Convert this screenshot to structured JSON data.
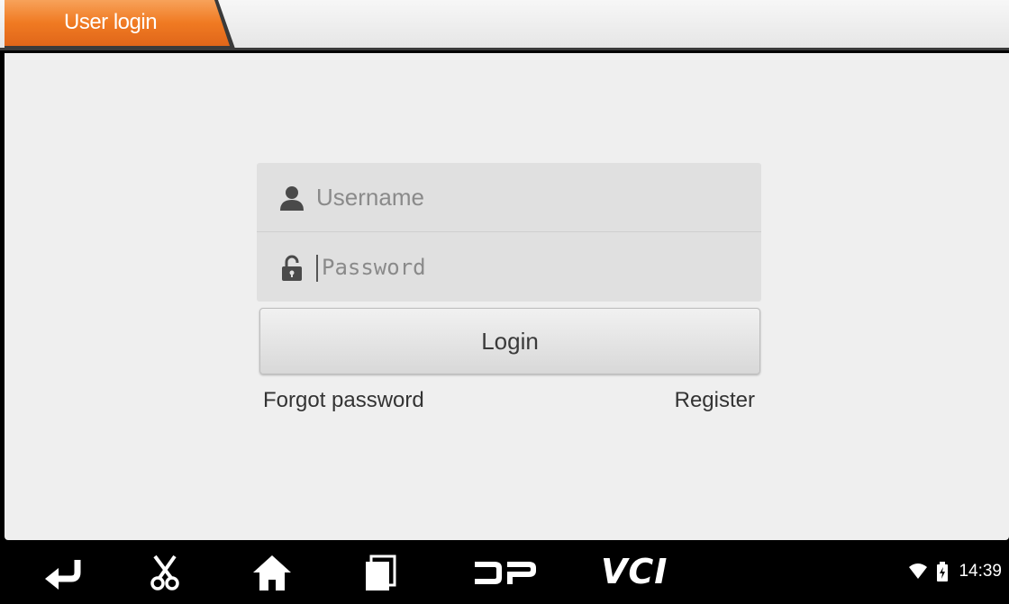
{
  "header": {
    "title": "User login",
    "accent_color": "#f07a22"
  },
  "login": {
    "username_placeholder": "Username",
    "password_placeholder": "Password",
    "login_label": "Login",
    "forgot_password_label": "Forgot password",
    "register_label": "Register"
  },
  "navbar": {
    "buttons": [
      {
        "name": "back",
        "icon": "back-arrow-icon"
      },
      {
        "name": "screenshot",
        "icon": "scissors-icon"
      },
      {
        "name": "home",
        "icon": "home-icon"
      },
      {
        "name": "recent",
        "icon": "recent-apps-icon"
      },
      {
        "name": "dp",
        "icon": "dp-logo-icon"
      },
      {
        "name": "vci",
        "label": "VCI"
      }
    ],
    "vci_label": "VCI",
    "status": {
      "wifi_icon": "wifi-icon",
      "battery_icon": "battery-icon",
      "time": "14:39"
    }
  }
}
